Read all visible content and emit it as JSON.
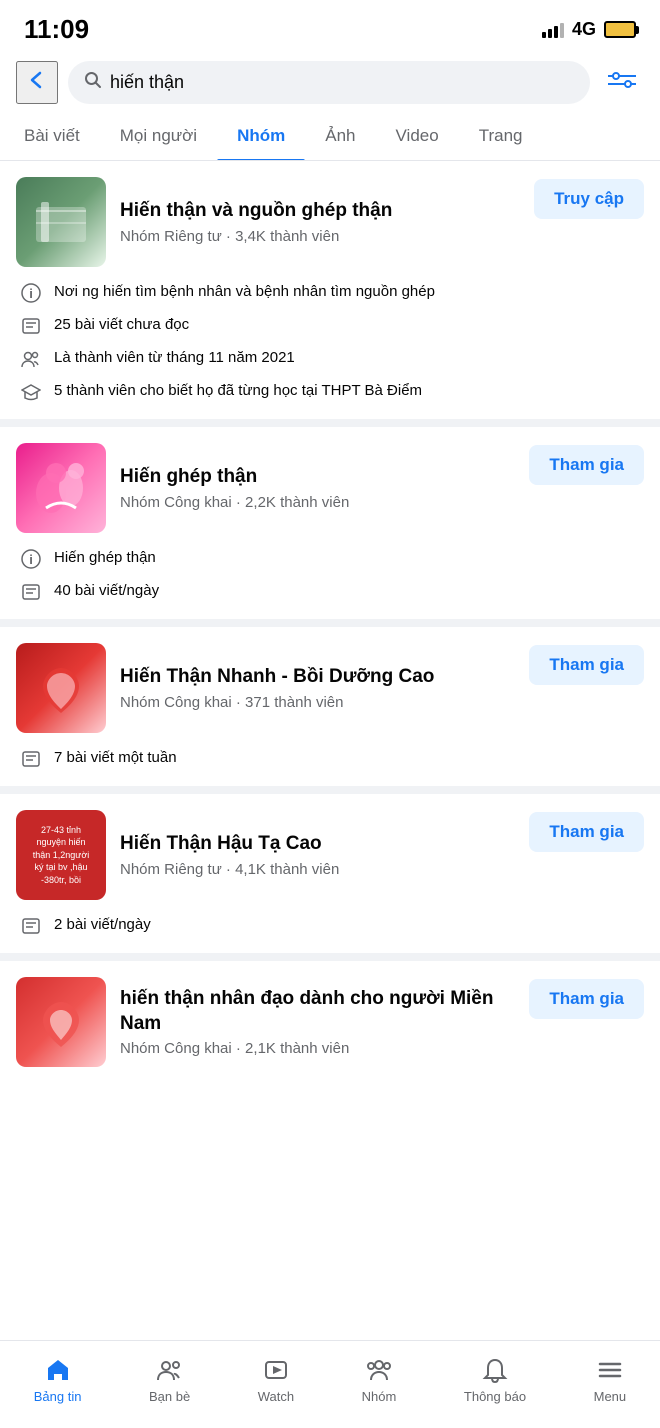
{
  "statusBar": {
    "time": "11:09",
    "signal": "4G"
  },
  "searchBar": {
    "query": "hiến thận",
    "backLabel": "‹",
    "filterLabel": "filter"
  },
  "filterTabs": [
    {
      "id": "bai-viet",
      "label": "Bài viết",
      "active": false
    },
    {
      "id": "moi-nguoi",
      "label": "Mọi người",
      "active": false
    },
    {
      "id": "nhom",
      "label": "Nhóm",
      "active": true
    },
    {
      "id": "anh",
      "label": "Ảnh",
      "active": false
    },
    {
      "id": "video",
      "label": "Video",
      "active": false
    },
    {
      "id": "trang",
      "label": "Trang",
      "active": false
    }
  ],
  "groups": [
    {
      "id": "group1",
      "name": "Hiến thận và nguồn ghép thận",
      "meta": "Nhóm Riêng tư · 3,4K thành viên",
      "actionLabel": "Truy cập",
      "actionType": "truy-cap",
      "details": [
        {
          "icon": "info",
          "text": "Nơi ng hiến tìm bệnh nhân và bệnh nhân tìm nguồn ghép"
        },
        {
          "icon": "posts",
          "text": "25 bài viết chưa đọc"
        },
        {
          "icon": "members",
          "text": "Là thành viên từ tháng 11 năm 2021"
        },
        {
          "icon": "school",
          "text": "5 thành viên cho biết họ đã từng học tại THPT Bà Điểm"
        }
      ]
    },
    {
      "id": "group2",
      "name": "Hiến ghép thận",
      "meta": "Nhóm Công khai · 2,2K thành viên",
      "actionLabel": "Tham gia",
      "actionType": "tham-gia",
      "details": [
        {
          "icon": "info",
          "text": "Hiến ghép thận"
        },
        {
          "icon": "posts",
          "text": "40 bài viết/ngày"
        }
      ]
    },
    {
      "id": "group3",
      "name": "Hiến Thận Nhanh - Bồi Dưỡng Cao",
      "meta": "Nhóm Công khai · 371 thành viên",
      "actionLabel": "Tham gia",
      "actionType": "tham-gia",
      "details": [
        {
          "icon": "posts",
          "text": "7 bài viết một tuần"
        }
      ]
    },
    {
      "id": "group4",
      "name": "Hiến Thận Hậu Tạ Cao",
      "meta": "Nhóm Riêng tư · 4,1K thành viên",
      "actionLabel": "Tham gia",
      "actionType": "tham-gia",
      "details": [
        {
          "icon": "posts",
          "text": "2 bài viết/ngày"
        }
      ]
    },
    {
      "id": "group5",
      "name": "hiến thận nhân đạo dành cho người Miền Nam",
      "meta": "Nhóm Công khai · 2,1K thành viên",
      "actionLabel": "Tham gia",
      "actionType": "tham-gia",
      "details": []
    }
  ],
  "bottomNav": [
    {
      "id": "bang-tin",
      "label": "Bảng tin",
      "active": true,
      "icon": "home"
    },
    {
      "id": "ban-be",
      "label": "Bạn bè",
      "active": false,
      "icon": "friends"
    },
    {
      "id": "watch",
      "label": "Watch",
      "active": false,
      "icon": "watch"
    },
    {
      "id": "nhom",
      "label": "Nhóm",
      "active": false,
      "icon": "groups"
    },
    {
      "id": "thong-bao",
      "label": "Thông báo",
      "active": false,
      "icon": "bell"
    },
    {
      "id": "menu",
      "label": "Menu",
      "active": false,
      "icon": "menu"
    }
  ],
  "imgTexts": {
    "group4ImgLine1": "27-43 tỉnh",
    "group4ImgLine2": "nguyện hiến",
    "group4ImgLine3": "thận 1,2người",
    "group4ImgLine4": "ký tại bv ,hậu",
    "group4ImgLine5": "-380tr, bồi"
  }
}
